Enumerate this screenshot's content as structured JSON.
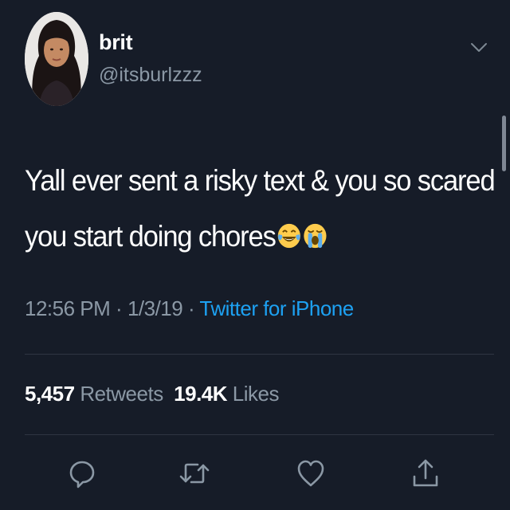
{
  "user": {
    "display_name": "brit",
    "handle": "@itsburlzzz"
  },
  "tweet": {
    "line1": "Yall ever sent a risky text & you so scared",
    "line2": "you start doing chores",
    "emojis": [
      "face-with-tears-of-joy",
      "loudly-crying-face"
    ]
  },
  "meta": {
    "time": "12:56 PM",
    "sep1": "·",
    "date": "1/3/19",
    "sep2": "·",
    "source": "Twitter for iPhone"
  },
  "stats": {
    "retweets_count": "5,457",
    "retweets_label": "Retweets",
    "likes_count": "19.4K",
    "likes_label": "Likes"
  },
  "actions": [
    "reply-icon",
    "retweet-icon",
    "like-icon",
    "share-icon"
  ],
  "colors": {
    "background": "#161c28",
    "secondary_text": "#8b98a5",
    "link": "#1da1f2",
    "divider": "#2f3542"
  }
}
